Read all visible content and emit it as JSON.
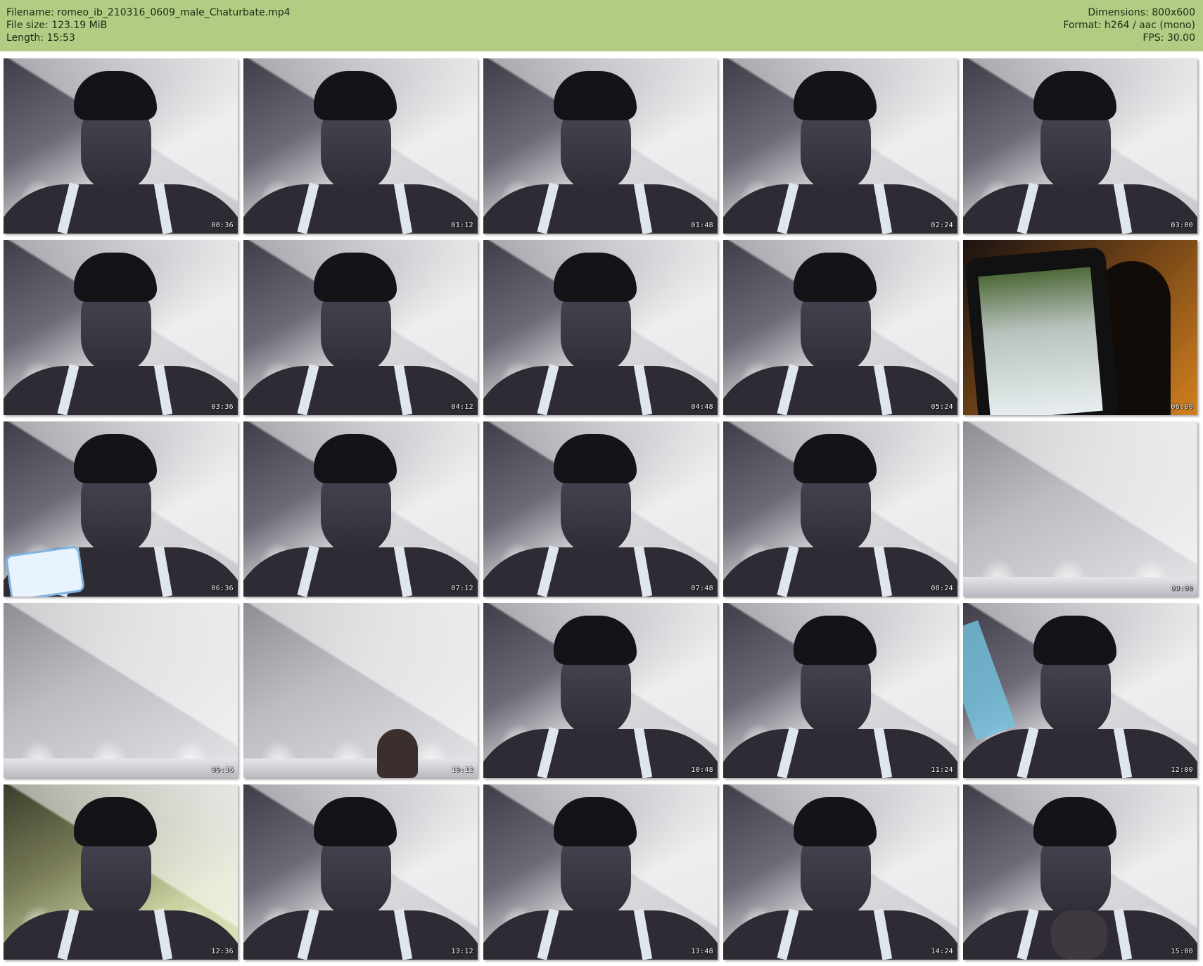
{
  "header": {
    "filename": "Filename: romeo_ib_210316_0609_male_Chaturbate.mp4",
    "filesize": "File size: 123.19 MiB",
    "length": "Length: 15:53",
    "dimensions": "Dimensions: 800x600",
    "format": "Format: h264 / aac (mono)",
    "fps": "FPS: 30.00"
  },
  "colors": {
    "header_bg": "#b2cc84",
    "timestamp": "#ffffff"
  },
  "thumbnails": [
    {
      "time": "00:36",
      "scene": "face"
    },
    {
      "time": "01:12",
      "scene": "face"
    },
    {
      "time": "01:48",
      "scene": "face"
    },
    {
      "time": "02:24",
      "scene": "face"
    },
    {
      "time": "03:00",
      "scene": "face"
    },
    {
      "time": "03:36",
      "scene": "face"
    },
    {
      "time": "04:12",
      "scene": "face"
    },
    {
      "time": "04:48",
      "scene": "face"
    },
    {
      "time": "05:24",
      "scene": "face"
    },
    {
      "time": "06:00",
      "scene": "phone-screen"
    },
    {
      "time": "06:36",
      "scene": "face-phone"
    },
    {
      "time": "07:12",
      "scene": "face"
    },
    {
      "time": "07:48",
      "scene": "face"
    },
    {
      "time": "08:24",
      "scene": "face"
    },
    {
      "time": "09:00",
      "scene": "empty"
    },
    {
      "time": "09:36",
      "scene": "empty"
    },
    {
      "time": "10:12",
      "scene": "empty-peek"
    },
    {
      "time": "10:48",
      "scene": "face"
    },
    {
      "time": "11:24",
      "scene": "face"
    },
    {
      "time": "12:00",
      "scene": "face-blur"
    },
    {
      "time": "12:36",
      "scene": "face-green"
    },
    {
      "time": "13:12",
      "scene": "face"
    },
    {
      "time": "13:48",
      "scene": "face"
    },
    {
      "time": "14:24",
      "scene": "face"
    },
    {
      "time": "15:00",
      "scene": "face-hand"
    }
  ]
}
